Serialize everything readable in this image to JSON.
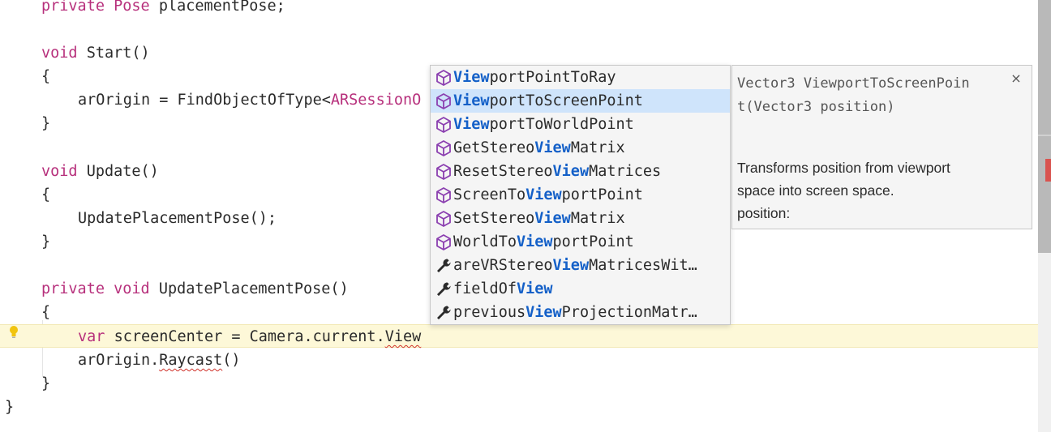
{
  "code": {
    "line_placement_pose": {
      "kw": "private",
      "type": "Pose",
      "rest": "placementPose;"
    },
    "line_start_sig": {
      "kw": "void",
      "rest": "Start()"
    },
    "brace_open": "{",
    "brace_close": "}",
    "line_ar_origin": {
      "plain": "arOrigin = FindObjectOfType<",
      "type": "ARSessionO"
    },
    "line_update_sig": {
      "kw": "void",
      "rest": "Update()"
    },
    "line_update_call": "UpdatePlacementPose();",
    "line_upp_sig": {
      "kw1": "private",
      "kw2": "void",
      "rest": "UpdatePlacementPose()"
    },
    "line_screen_center": {
      "kw": "var",
      "plain": "screenCenter = Camera.current.",
      "err": "View"
    },
    "line_raycast": {
      "plain": "arOrigin.",
      "err": "Raycast",
      "end": "()"
    }
  },
  "completion": {
    "items": [
      {
        "pre": "",
        "hl": "View",
        "post": "portPointToRay",
        "icon": "method-cube-icon"
      },
      {
        "pre": "",
        "hl": "View",
        "post": "portToScreenPoint",
        "icon": "method-cube-icon",
        "selected": true
      },
      {
        "pre": "",
        "hl": "View",
        "post": "portToWorldPoint",
        "icon": "method-cube-icon"
      },
      {
        "pre": "GetStereo",
        "hl": "View",
        "post": "Matrix",
        "icon": "method-cube-icon"
      },
      {
        "pre": "ResetStereo",
        "hl": "View",
        "post": "Matrices",
        "icon": "method-cube-icon"
      },
      {
        "pre": "ScreenTo",
        "hl": "View",
        "post": "portPoint",
        "icon": "method-cube-icon"
      },
      {
        "pre": "SetStereo",
        "hl": "View",
        "post": "Matrix",
        "icon": "method-cube-icon"
      },
      {
        "pre": "WorldTo",
        "hl": "View",
        "post": "portPoint",
        "icon": "method-cube-icon"
      },
      {
        "pre": "areVRStereo",
        "hl": "View",
        "post": "MatricesWit…",
        "icon": "property-wrench-icon"
      },
      {
        "pre": "fieldOf",
        "hl": "View",
        "post": "",
        "icon": "property-wrench-icon"
      },
      {
        "pre": "previous",
        "hl": "View",
        "post": "ProjectionMatr…",
        "icon": "property-wrench-icon"
      }
    ]
  },
  "tooltip": {
    "signature_line1": "Vector3 ViewportToScreenPoin",
    "signature_line2": "t(Vector3 position)",
    "close_glyph": "×",
    "desc_line1": "Transforms position from viewport",
    "desc_line2": "space into screen space.",
    "desc_line3": "position:"
  },
  "colors": {
    "keyword": "#b7307c",
    "highlight": "#1460c8",
    "selected_row": "#cfe4fb",
    "current_line": "#fdf8d8",
    "error_squiggle": "#d0342c"
  }
}
